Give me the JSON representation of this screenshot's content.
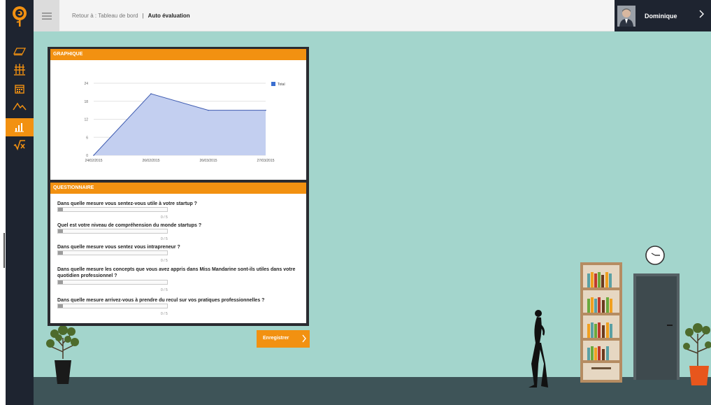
{
  "header": {
    "breadcrumb_back": "Retour à : Tableau de bord",
    "breadcrumb_separator": "|",
    "breadcrumb_current": "Auto évaluation",
    "user_name": "Dominique"
  },
  "sidebar": {
    "items": [
      {
        "icon": "book-icon",
        "active": false
      },
      {
        "icon": "columns-icon",
        "active": false
      },
      {
        "icon": "calendar-icon",
        "active": false
      },
      {
        "icon": "mountain-trend-icon",
        "active": false
      },
      {
        "icon": "bar-chart-icon",
        "active": true
      },
      {
        "icon": "square-root-icon",
        "active": false
      }
    ]
  },
  "graph": {
    "title": "GRAPHIQUE"
  },
  "chart_data": {
    "type": "area",
    "x": [
      "24/02/2015",
      "26/02/2015",
      "26/03/2015",
      "27/03/2015"
    ],
    "series": [
      {
        "name": "Total",
        "values": [
          0,
          20.5,
          15,
          15
        ]
      }
    ],
    "yticks": [
      0,
      6,
      12,
      18,
      24
    ],
    "ylim": [
      0,
      24
    ],
    "grid": true,
    "legend": "top-right",
    "colors": {
      "fill": "#c3cff0",
      "line": "#3e5bb0",
      "legend": "#3b6fd0"
    }
  },
  "questionnaire": {
    "title": "QUESTIONNAIRE",
    "questions": [
      {
        "label": "Dans quelle mesure vous sentez-vous utile à votre startup ?",
        "score": "0 / 5",
        "value": 0
      },
      {
        "label": "Quel est votre niveau de compréhension du monde startups ?",
        "score": "0 / 5",
        "value": 0
      },
      {
        "label": "Dans quelle mesure vous sentez vous intrapreneur ?",
        "score": "0 / 5",
        "value": 0
      },
      {
        "label": "Dans quelle mesure les concepts que vous avez appris dans Miss Mandarine sont-ils utiles dans votre quotidien professionnel ?",
        "score": "0 / 5",
        "value": 0
      },
      {
        "label": "Dans quelle mesure arrivez-vous à prendre du recul sur vos pratiques professionnelles ?",
        "score": "0 / 5",
        "value": 0
      }
    ]
  },
  "actions": {
    "save_label": "Enregistrer"
  },
  "colors": {
    "accent": "#f29111",
    "sidebar": "#1e2430",
    "wall": "#a3d5cc",
    "floor": "#3e5458"
  }
}
